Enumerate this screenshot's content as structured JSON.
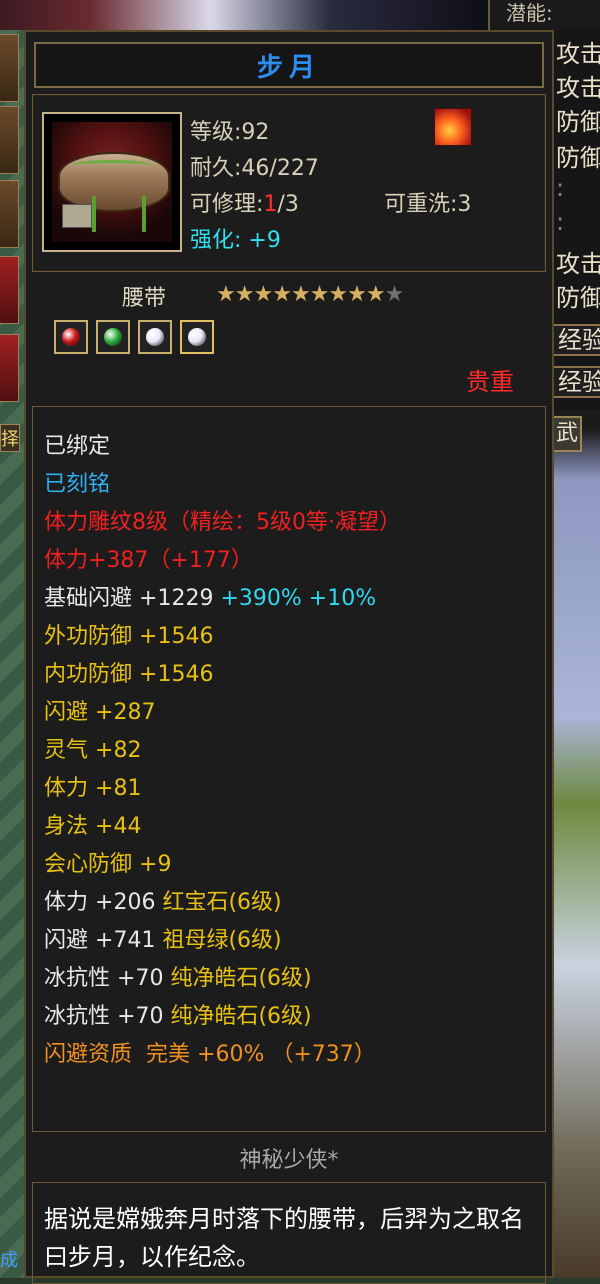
{
  "item": {
    "name": "步月",
    "level": "等级:92",
    "durability": "耐久:46/227",
    "repair_prefix": "可修理:",
    "repair_used": "1",
    "repair_total": "/3",
    "rewash": "可重洗:3",
    "enhance_label": "强化:",
    "enhance_value": "+9",
    "type": "腰带",
    "stars_filled": 9,
    "stars_total": 10,
    "rarity": "贵重",
    "gems": [
      {
        "icon": "ruby-gem-icon",
        "color": "#d01818"
      },
      {
        "icon": "emerald-gem-icon",
        "color": "#30b040"
      },
      {
        "icon": "diamond-gem-icon",
        "color": "#e8e8f8"
      },
      {
        "icon": "diamond-gem-icon",
        "color": "#e8e8f8"
      }
    ]
  },
  "attributes": {
    "bound": "已绑定",
    "engraved": "已刻铭",
    "carving": "体力雕纹8级（精绘：5级0等·凝望）",
    "stamina_total": "体力+387（+177）",
    "base_dodge_label": "基础闪避",
    "base_dodge_value": "+1229",
    "base_dodge_pct": "+390%",
    "base_dodge_pct2": "+10%",
    "ext_def_label": "外功防御",
    "ext_def_value": "+1546",
    "int_def_label": "内功防御",
    "int_def_value": "+1546",
    "dodge_label": "闪避",
    "dodge_value": "+287",
    "spirit_label": "灵气",
    "spirit_value": "+82",
    "stamina_label": "体力",
    "stamina_value": "+81",
    "agility_label": "身法",
    "agility_value": "+44",
    "crit_def_label": "会心防御",
    "crit_def_value": "+9",
    "gem_lines": [
      {
        "stat": "体力",
        "value": "+206",
        "gem": "红宝石",
        "level": "(6级)"
      },
      {
        "stat": "闪避",
        "value": "+741",
        "gem": "祖母绿",
        "level": "(6级)"
      },
      {
        "stat": "冰抗性",
        "value": "+70",
        "gem": "纯净皓石",
        "level": "(6级)"
      },
      {
        "stat": "冰抗性",
        "value": "+70",
        "gem": "纯净皓石",
        "level": "(6级)"
      }
    ],
    "aptitude_label": "闪避资质",
    "aptitude_grade": "完美",
    "aptitude_pct": "+60%",
    "aptitude_bonus": "（+737）"
  },
  "maker": "神秘少侠*",
  "description": "据说是嫦娥奔月时落下的腰带，后羿为之取名曰步月，以作纪念。",
  "side": {
    "top_label": "潜能:",
    "right_items": [
      "攻击",
      "攻击",
      "防御",
      "防御",
      ":",
      ":",
      "攻击",
      "防御"
    ],
    "right_buttons": [
      "经验",
      "经验"
    ],
    "right_tab": "武",
    "left_tab": "择",
    "left_bottom": "成"
  }
}
